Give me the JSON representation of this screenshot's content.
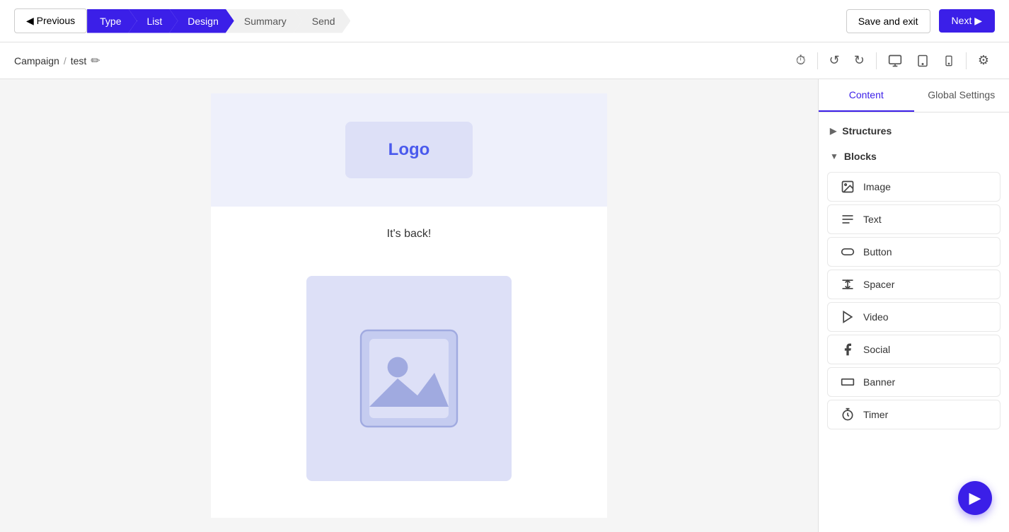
{
  "topNav": {
    "previousLabel": "◀ Previous",
    "nextLabel": "Next ▶",
    "saveExitLabel": "Save and exit",
    "steps": [
      {
        "id": "type",
        "label": "Type",
        "state": "active"
      },
      {
        "id": "list",
        "label": "List",
        "state": "active"
      },
      {
        "id": "design",
        "label": "Design",
        "state": "active"
      },
      {
        "id": "summary",
        "label": "Summary",
        "state": "inactive"
      },
      {
        "id": "send",
        "label": "Send",
        "state": "inactive"
      }
    ]
  },
  "subHeader": {
    "breadcrumbCampaign": "Campaign",
    "breadcrumbSep": "/",
    "breadcrumbTest": "test",
    "editIconLabel": "✏"
  },
  "toolbar": {
    "icons": [
      {
        "name": "history-icon",
        "symbol": "⏱"
      },
      {
        "name": "undo-icon",
        "symbol": "↺"
      },
      {
        "name": "redo-icon",
        "symbol": "↻"
      },
      {
        "name": "desktop-icon",
        "symbol": "🖥"
      },
      {
        "name": "tablet-icon",
        "symbol": "📱"
      },
      {
        "name": "mobile-icon",
        "symbol": "📲"
      },
      {
        "name": "settings-icon",
        "symbol": "⚙"
      }
    ]
  },
  "canvas": {
    "logoText": "Logo",
    "bodyText": "It's back!"
  },
  "rightPanel": {
    "tabs": [
      {
        "id": "content",
        "label": "Content",
        "active": true
      },
      {
        "id": "global-settings",
        "label": "Global Settings",
        "active": false
      }
    ],
    "sections": {
      "structures": {
        "label": "Structures",
        "collapsed": true
      },
      "blocks": {
        "label": "Blocks",
        "collapsed": false,
        "items": [
          {
            "id": "image",
            "label": "Image",
            "icon": "🖼"
          },
          {
            "id": "text",
            "label": "Text",
            "icon": "≡"
          },
          {
            "id": "button",
            "label": "Button",
            "icon": "⬭"
          },
          {
            "id": "spacer",
            "label": "Spacer",
            "icon": "⬒"
          },
          {
            "id": "video",
            "label": "Video",
            "icon": "▶"
          },
          {
            "id": "social",
            "label": "Social",
            "icon": "f"
          },
          {
            "id": "banner",
            "label": "Banner",
            "icon": "⬛"
          },
          {
            "id": "timer",
            "label": "Timer",
            "icon": "⏱"
          }
        ]
      }
    }
  },
  "fab": {
    "label": "▶"
  }
}
